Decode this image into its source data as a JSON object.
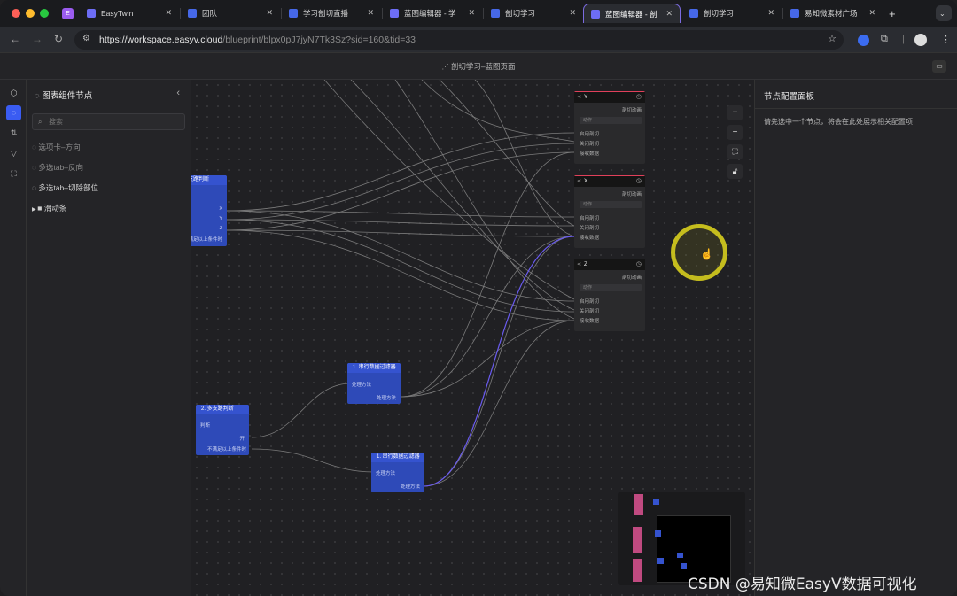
{
  "browser": {
    "tabs": [
      {
        "label": "EasyTwin",
        "favicon": "E"
      },
      {
        "label": "团队",
        "favicon": "E"
      },
      {
        "label": "学习剖切直播",
        "favicon": "E"
      },
      {
        "label": "蓝图编辑器 - 学",
        "favicon": "E"
      },
      {
        "label": "剖切学习",
        "favicon": "E"
      },
      {
        "label": "蓝图编辑器 - 剖",
        "favicon": "E"
      },
      {
        "label": "剖切学习",
        "favicon": "E"
      },
      {
        "label": "易知微素材广场",
        "favicon": "E"
      }
    ],
    "url_host": "https://workspace.easyv.cloud",
    "url_path": "/blueprint/blpx0pJ7jyN7Tk3Sz?sid=160&tid=33",
    "accent": "#7b6be0"
  },
  "editor": {
    "title": "剖切学习–蓝图页面"
  },
  "left_panel": {
    "title": "图表组件节点",
    "search_placeholder": "搜索",
    "items": [
      {
        "label": "选项卡–方向"
      },
      {
        "label": "多选tab–反向"
      },
      {
        "label": "多选tab–切除部位"
      },
      {
        "label": "滑动条"
      }
    ]
  },
  "right_panel": {
    "title": "节点配置面板",
    "hint": "请先选中一个节点，将会在此处展示相关配置项"
  },
  "nodes": {
    "branch1": {
      "title": "支路判断",
      "ports": [
        "X",
        "Y",
        "Z",
        "不满足以上条件时"
      ]
    },
    "branch2": {
      "title": "2. 多支路判断",
      "input": "判断",
      "outputs": [
        "开",
        "不满足以上条件时"
      ]
    },
    "filter1": {
      "title": "1. 串行数据过滤器",
      "input": "处理方法",
      "output": "处理方法"
    },
    "filter2": {
      "title": "1. 串行数据过滤器",
      "input": "处理方法",
      "output": "处理方法"
    },
    "targets": [
      {
        "title": "Y",
        "sub": "剖切动画",
        "action": "动作",
        "ports": [
          "启用剖切",
          "关闭剖切",
          "接收数据"
        ]
      },
      {
        "title": "X",
        "sub": "剖切动画",
        "action": "动作",
        "ports": [
          "启用剖切",
          "关闭剖切",
          "接收数据"
        ]
      },
      {
        "title": "Z",
        "sub": "剖切动画",
        "action": "动作",
        "ports": [
          "启用剖切",
          "关闭剖切",
          "接收数据"
        ]
      }
    ]
  },
  "watermark": "CSDN @易知微EasyV数据可视化"
}
